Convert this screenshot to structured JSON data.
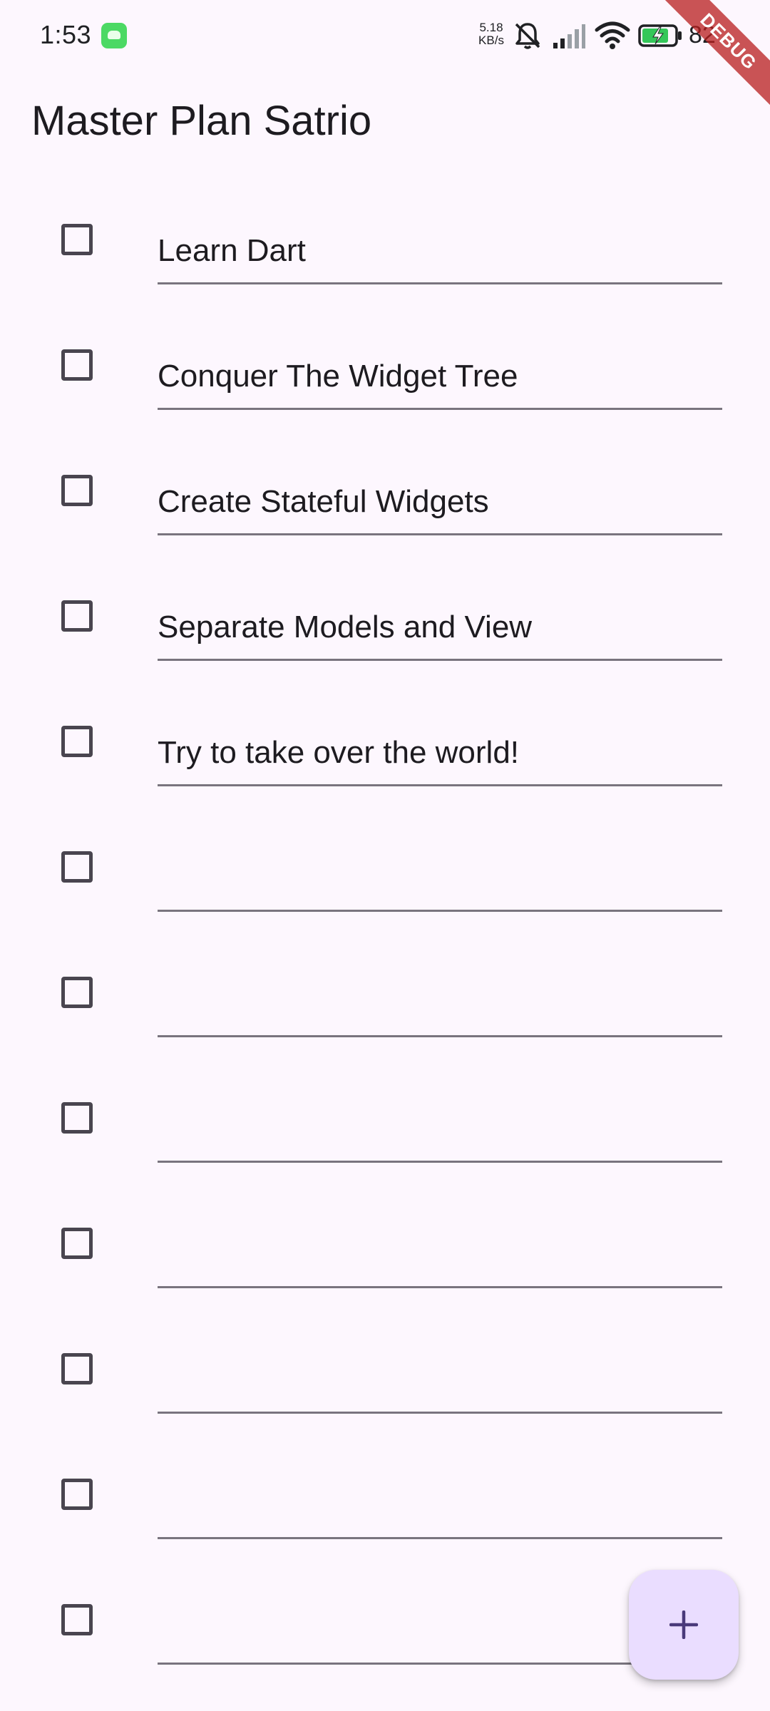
{
  "status_bar": {
    "time": "1:53",
    "net_speed_value": "5.18",
    "net_speed_unit": "KB/s",
    "battery_percent": "82",
    "app_icon": "green-app-icon",
    "icons": [
      "muted-bell-icon",
      "signal-icon",
      "wifi-icon",
      "battery-charging-icon"
    ]
  },
  "debug_banner": {
    "label": "DEBUG",
    "color": "#b71c1c"
  },
  "app_bar": {
    "title": "Master Plan Satrio"
  },
  "tasks": [
    {
      "description": "Learn Dart",
      "complete": false
    },
    {
      "description": "Conquer The Widget Tree",
      "complete": false
    },
    {
      "description": "Create Stateful Widgets",
      "complete": false
    },
    {
      "description": "Separate Models and View",
      "complete": false
    },
    {
      "description": "Try to take over the world!",
      "complete": false
    },
    {
      "description": "",
      "complete": false
    },
    {
      "description": "",
      "complete": false
    },
    {
      "description": "",
      "complete": false
    },
    {
      "description": "",
      "complete": false
    },
    {
      "description": "",
      "complete": false
    },
    {
      "description": "",
      "complete": false
    },
    {
      "description": "",
      "complete": false
    }
  ],
  "fab": {
    "icon": "add-icon"
  },
  "colors": {
    "background": "#fdf7fe",
    "fab_background": "#eaddff",
    "fab_icon": "#4a3a7a",
    "checkbox_border": "#49454f",
    "underline": "#79747e",
    "text": "#1d1b20"
  }
}
